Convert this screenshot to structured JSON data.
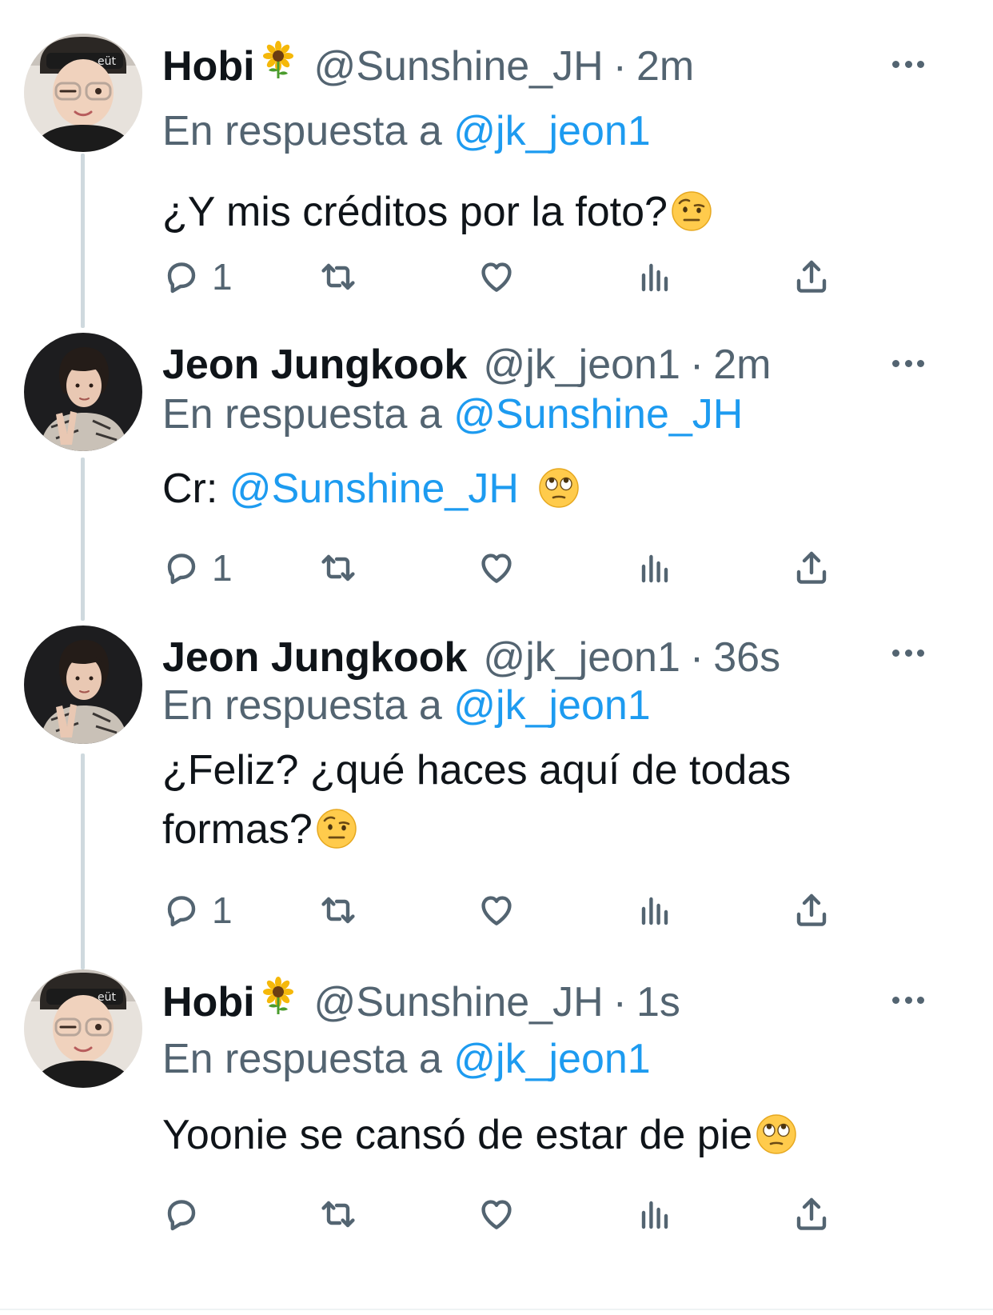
{
  "tweets": [
    {
      "name": "Hobi",
      "handle": "@Sunshine_JH",
      "separator": "·",
      "time": "2m",
      "reply_prefix": "En respuesta a",
      "reply_to": "@jk_jeon1",
      "text": "¿Y mis créditos por la foto?",
      "text_emoji": "raised-eyebrow-emoji",
      "reply_count": "1",
      "avatar": "hobi-avatar"
    },
    {
      "name": "Jeon Jungkook",
      "handle": "@jk_jeon1",
      "separator": "·",
      "time": "2m",
      "reply_prefix": "En respuesta a",
      "reply_to": "@Sunshine_JH",
      "text_prefix": "Cr:",
      "text_mention": "@Sunshine_JH",
      "text_emoji": "eye-roll-emoji",
      "reply_count": "1",
      "avatar": "jungkook-avatar"
    },
    {
      "name": "Jeon Jungkook",
      "handle": "@jk_jeon1",
      "separator": "·",
      "time": "36s",
      "reply_prefix": "En respuesta a",
      "reply_to": "@jk_jeon1",
      "text_line1": "¿Feliz? ¿qué haces aquí de todas",
      "text_line2": "formas?",
      "text_emoji": "raised-eyebrow-emoji",
      "reply_count": "1",
      "avatar": "jungkook-avatar"
    },
    {
      "name": "Hobi",
      "handle": "@Sunshine_JH",
      "separator": "·",
      "time": "1s",
      "reply_prefix": "En respuesta a",
      "reply_to": "@jk_jeon1",
      "text": "Yoonie se cansó de estar de pie",
      "text_emoji": "eye-roll-emoji",
      "reply_count": "",
      "avatar": "hobi-avatar"
    }
  ],
  "icons": {
    "reply": "reply-icon",
    "retweet": "retweet-icon",
    "like": "heart-icon",
    "views": "views-icon",
    "share": "share-icon",
    "more": "more-icon",
    "name_emoji": "sunflower-emoji"
  },
  "colors": {
    "link": "#1d9bf0",
    "secondary_text": "#536471",
    "primary_text": "#0f1419",
    "thread_line": "#cfd9de"
  }
}
